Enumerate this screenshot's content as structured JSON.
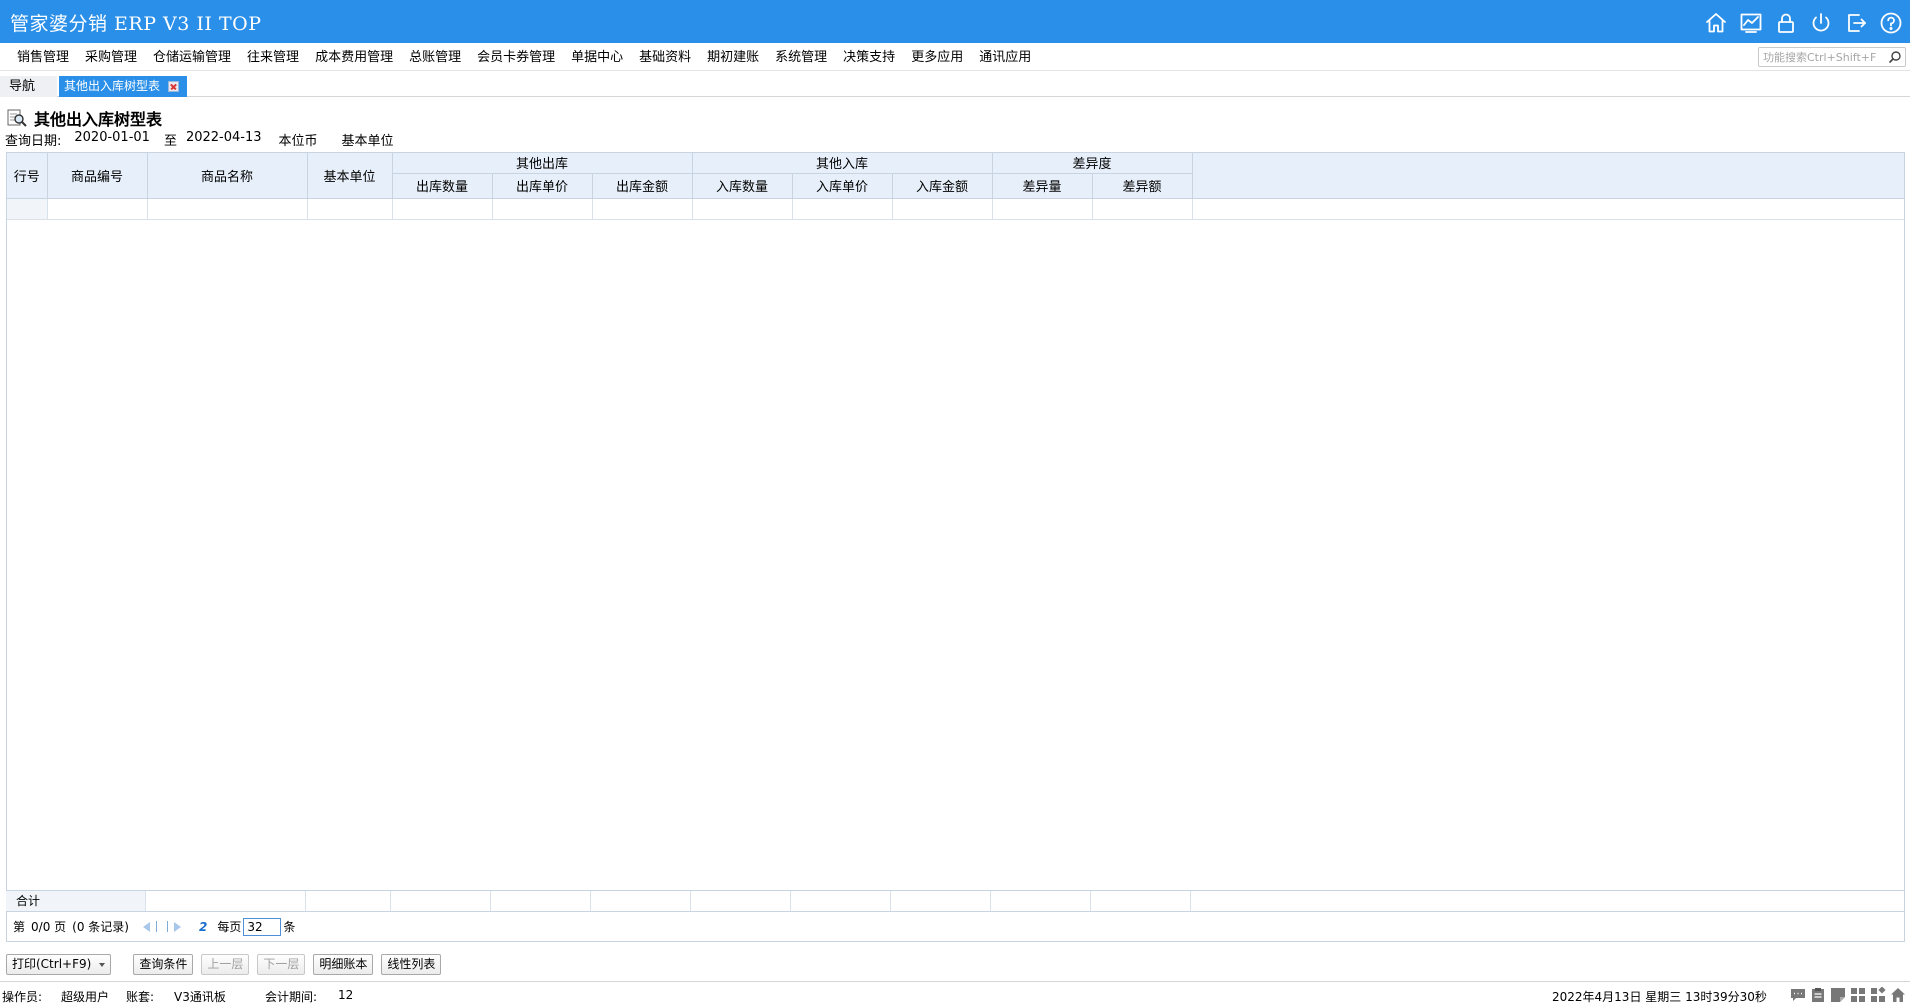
{
  "app": {
    "title": "管家婆分销 ERP V3 II TOP"
  },
  "title_icons": [
    "home-icon",
    "chart-icon",
    "lock-icon",
    "power-icon",
    "exit-icon",
    "help-icon"
  ],
  "menu": {
    "items": [
      "销售管理",
      "采购管理",
      "仓储运输管理",
      "往来管理",
      "成本费用管理",
      "总账管理",
      "会员卡券管理",
      "单据中心",
      "基础资料",
      "期初建账",
      "系统管理",
      "决策支持",
      "更多应用",
      "通讯应用"
    ],
    "search_placeholder": "功能搜索Ctrl+Shift+F"
  },
  "tabs": {
    "nav": "导航",
    "active": "其他出入库树型表"
  },
  "report": {
    "title": "其他出入库树型表",
    "query_label": "查询日期:",
    "date_from": "2020-01-01",
    "to_label": "至",
    "date_to": "2022-04-13",
    "currency": "本位币",
    "unit": "基本单位"
  },
  "table": {
    "columns": {
      "row_no": "行号",
      "code": "商品编号",
      "name": "商品名称",
      "unit": "基本单位"
    },
    "groups": [
      {
        "label": "其他出库",
        "cols": [
          "出库数量",
          "出库单价",
          "出库金额"
        ]
      },
      {
        "label": "其他入库",
        "cols": [
          "入库数量",
          "入库单价",
          "入库金额"
        ]
      },
      {
        "label": "差异度",
        "cols": [
          "差异量",
          "差异额"
        ]
      }
    ],
    "total_label": "合计"
  },
  "pager": {
    "page_prefix": "第",
    "page_info": "0/0 页",
    "records": "(0 条记录)",
    "refresh": "2",
    "per_page_label": "每页",
    "per_page": "32",
    "per_page_suffix": "条"
  },
  "buttons": {
    "print": "打印(Ctrl+F9)",
    "query": "查询条件",
    "up": "上一层",
    "down": "下一层",
    "detail": "明细账本",
    "linear": "线性列表"
  },
  "status": {
    "operator_label": "操作员:",
    "operator": "超级用户",
    "account_label": "账套:",
    "account": "V3通讯板",
    "period_label": "会计期间:",
    "period": "12",
    "datetime": "2022年4月13日  星期三  13时39分30秒"
  },
  "colors": {
    "titlebar": "#2a8fe8",
    "header_bg": "#e7f0fa"
  }
}
